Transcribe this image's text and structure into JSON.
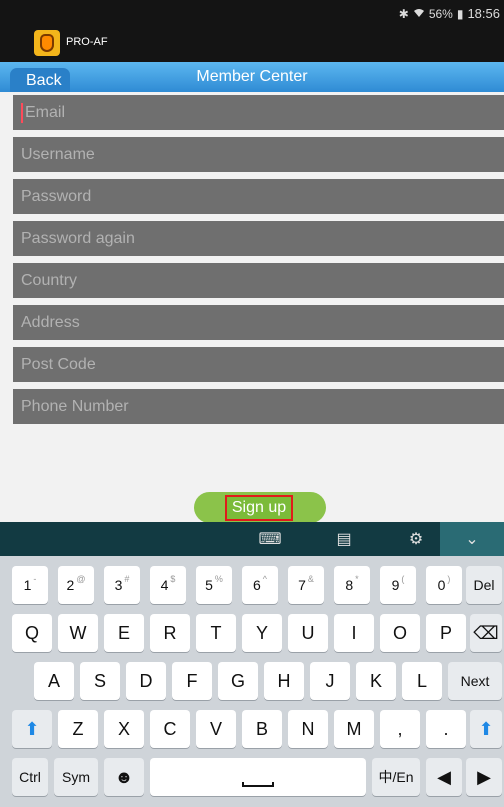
{
  "status_bar": {
    "icons": [
      "bluetooth-icon",
      "wifi-icon"
    ],
    "battery": "56%",
    "time": "18:56"
  },
  "app_bar": {
    "title": "PRO-AF"
  },
  "nav_bar": {
    "back_label": "Back",
    "title": "Member Center"
  },
  "form": {
    "fields": [
      {
        "placeholder": "Email"
      },
      {
        "placeholder": "Username"
      },
      {
        "placeholder": "Password"
      },
      {
        "placeholder": "Password again"
      },
      {
        "placeholder": "Country"
      },
      {
        "placeholder": "Address"
      },
      {
        "placeholder": "Post Code"
      },
      {
        "placeholder": "Phone Number"
      }
    ],
    "signup_label": "Sign up"
  },
  "keyboard": {
    "top_controls": [
      "keyboard-icon",
      "clipboard-icon",
      "gear-icon",
      "chevron-down-icon"
    ],
    "row1": [
      {
        "label": "1",
        "sup": "-"
      },
      {
        "label": "2",
        "sup": "@"
      },
      {
        "label": "3",
        "sup": "#"
      },
      {
        "label": "4",
        "sup": "$"
      },
      {
        "label": "5",
        "sup": "%"
      },
      {
        "label": "6",
        "sup": "^"
      },
      {
        "label": "7",
        "sup": "&"
      },
      {
        "label": "8",
        "sup": "*"
      },
      {
        "label": "9",
        "sup": "("
      },
      {
        "label": "0",
        "sup": ")"
      }
    ],
    "del_label": "Del",
    "row2": [
      "Q",
      "W",
      "E",
      "R",
      "T",
      "Y",
      "U",
      "I",
      "O",
      "P"
    ],
    "row3": [
      "A",
      "S",
      "D",
      "F",
      "G",
      "H",
      "J",
      "K",
      "L"
    ],
    "next_label": "Next",
    "row4": [
      "Z",
      "X",
      "C",
      "V",
      "B",
      "N",
      "M"
    ],
    "comma_label": ",",
    "period_label": ".",
    "ctrl_label": "Ctrl",
    "sym_label": "Sym",
    "lang_label": "中/En"
  }
}
